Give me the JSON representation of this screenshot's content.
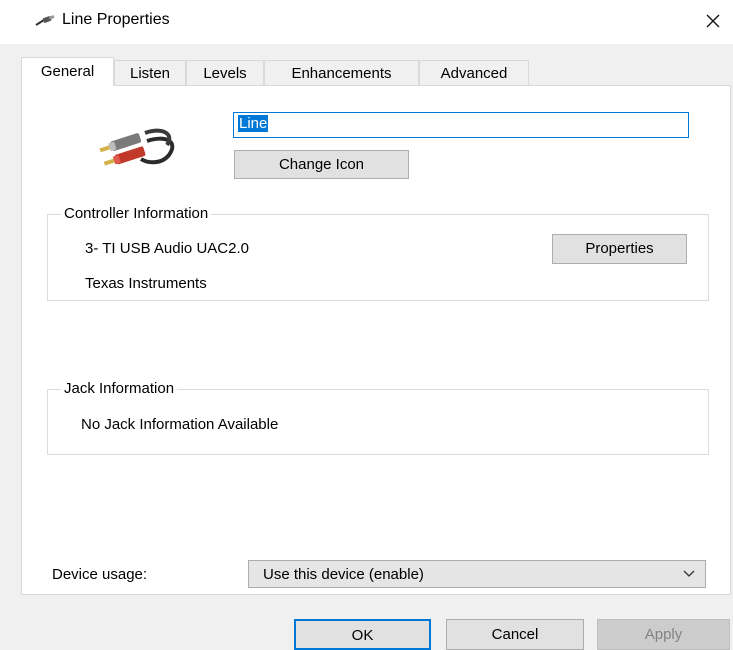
{
  "window": {
    "title": "Line Properties",
    "title_icon": "audio-cable-icon",
    "close_icon": "close-icon"
  },
  "tabs": [
    {
      "label": "General",
      "active": true
    },
    {
      "label": "Listen",
      "active": false
    },
    {
      "label": "Levels",
      "active": false
    },
    {
      "label": "Enhancements",
      "active": false
    },
    {
      "label": "Advanced",
      "active": false
    }
  ],
  "general": {
    "device_icon": "rca-cable-icon",
    "name_value": "Line",
    "change_icon_label": "Change Icon",
    "controller": {
      "legend": "Controller Information",
      "device": "3- TI USB Audio UAC2.0",
      "manufacturer": "Texas Instruments",
      "properties_label": "Properties"
    },
    "jack": {
      "legend": "Jack Information",
      "text": "No Jack Information Available"
    },
    "device_usage": {
      "label": "Device usage:",
      "selected": "Use this device (enable)",
      "chevron_icon": "chevron-down-icon"
    }
  },
  "footer": {
    "ok_label": "OK",
    "cancel_label": "Cancel",
    "apply_label": "Apply"
  }
}
